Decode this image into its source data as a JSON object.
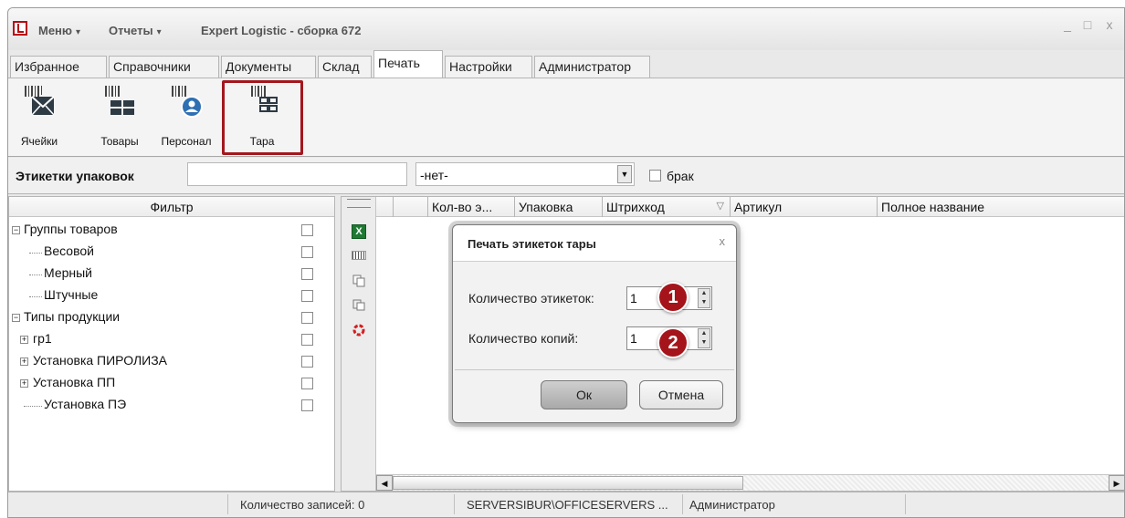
{
  "window": {
    "menu_label": "Меню",
    "reports_label": "Отчеты",
    "title": "Expert Logistic - сборка 672"
  },
  "tabs": [
    {
      "label": "Избранное"
    },
    {
      "label": "Справочники"
    },
    {
      "label": "Документы"
    },
    {
      "label": "Склад"
    },
    {
      "label": "Печать"
    },
    {
      "label": "Настройки"
    },
    {
      "label": "Администратор"
    }
  ],
  "active_tab": "Печать",
  "ribbon": {
    "buttons": [
      {
        "label": "Ячейки",
        "icon": "barcode-envelope-icon"
      },
      {
        "label": "Товары",
        "icon": "barcode-boxes-icon"
      },
      {
        "label": "Персонал",
        "icon": "barcode-person-icon"
      },
      {
        "label": "Тара",
        "icon": "barcode-container-icon"
      }
    ],
    "highlighted": "Тара",
    "highlight_color": "#a3171e"
  },
  "search": {
    "title": "Этикетки упаковок",
    "input_value": "",
    "select_value": "-нет-",
    "brak_label": "брак"
  },
  "filter": {
    "header": "Фильтр",
    "tree": [
      {
        "label": "Группы товаров",
        "expander": "−"
      },
      {
        "label": "Весовой"
      },
      {
        "label": "Мерный"
      },
      {
        "label": "Штучные"
      },
      {
        "label": "Типы продукции",
        "expander": "−"
      },
      {
        "label": "гр1",
        "expander": "+"
      },
      {
        "label": "Установка ПИРОЛИЗА",
        "expander": "+"
      },
      {
        "label": "Установка ПП",
        "expander": "+"
      },
      {
        "label": "Установка ПЭ"
      }
    ]
  },
  "grid": {
    "columns": [
      "Кол-во э...",
      "Упаковка",
      "Штрихкод",
      "Артикул",
      "Полное название"
    ],
    "tools": [
      "excel-icon",
      "barcode-icon",
      "copy-icon",
      "paste-icon",
      "refresh-icon"
    ]
  },
  "status": {
    "records": "Количество записей: 0",
    "server": "SERVERSIBUR\\OFFICESERVERS ...",
    "user": "Администратор"
  },
  "dialog": {
    "title": "Печать этикеток тары",
    "close": "x",
    "labels_count_label": "Количество этикеток:",
    "labels_count_value": "1",
    "copies_label": "Количество копий:",
    "copies_value": "1",
    "badge_1": "1",
    "badge_2": "2",
    "ok_label": "Ок",
    "cancel_label": "Отмена",
    "accent": "#a5141b"
  }
}
